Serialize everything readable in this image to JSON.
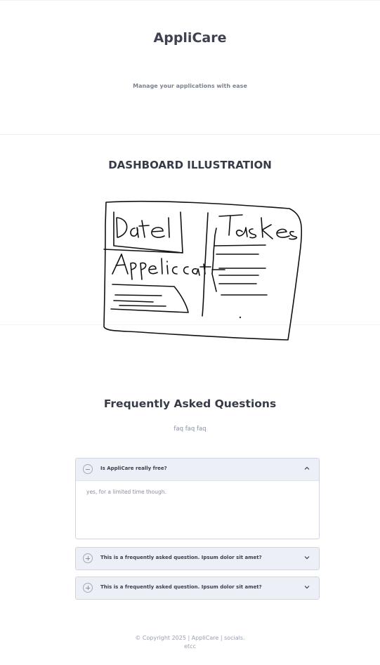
{
  "hero": {
    "title": "AppliCare",
    "tagline": "Manage your applications with ease"
  },
  "illustration": {
    "heading": "DASHBOARD ILLUSTRATION",
    "sketch_labels": [
      "Date",
      "Tasks",
      "Applications"
    ]
  },
  "faq": {
    "title": "Frequently Asked Questions",
    "subtitle": "faq faq faq",
    "items": [
      {
        "question": "Is AppliCare really free?",
        "answer": "yes, for a limited time though.",
        "expanded": true,
        "toggle_icon": "minus-circle-icon",
        "chevron_icon": "chevron-up-icon"
      },
      {
        "question": "This is a frequently asked question. Ipsum dolor sit amet?",
        "answer": "",
        "expanded": false,
        "toggle_icon": "plus-circle-icon",
        "chevron_icon": "chevron-down-icon"
      },
      {
        "question": "This is a frequently asked question. Ipsum dolor sit amet?",
        "answer": "",
        "expanded": false,
        "toggle_icon": "plus-circle-icon",
        "chevron_icon": "chevron-down-icon"
      }
    ]
  },
  "footer": {
    "copyright_line1": "© Copyright 2025 | AppliCare | socials.",
    "copyright_line2": "etcc"
  },
  "colors": {
    "text_dark": "#3d4150",
    "text_muted": "#8a8f9c",
    "accordion_header_bg": "#eceff5",
    "accordion_border": "#cfd5e0"
  }
}
